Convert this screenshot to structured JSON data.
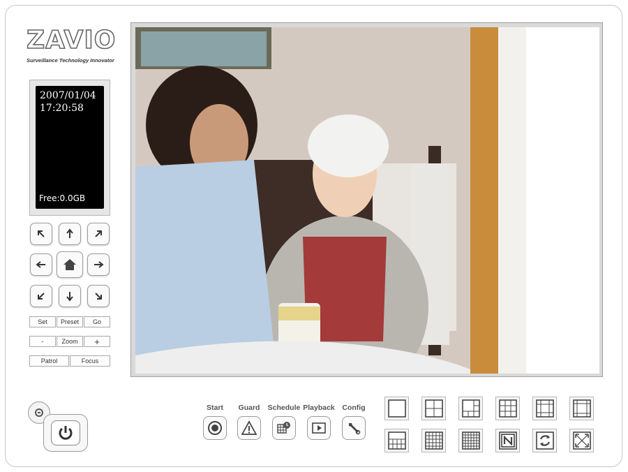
{
  "logo": {
    "text": "ZAVIO",
    "tagline": "Surveillance Technology Innovator"
  },
  "status": {
    "date": "2007/01/04",
    "time": "17:20:58",
    "free": "Free:0.0GB"
  },
  "ptz": {
    "set": "Set",
    "preset": "Preset",
    "go": "Go",
    "zoom_minus": "-",
    "zoom": "Zoom",
    "zoom_plus": "+",
    "patrol": "Patrol",
    "focus": "Focus"
  },
  "functions": [
    {
      "label": "Start",
      "icon": "record-icon"
    },
    {
      "label": "Guard",
      "icon": "warning-icon"
    },
    {
      "label": "Schedule",
      "icon": "schedule-icon"
    },
    {
      "label": "Playback",
      "icon": "play-icon"
    },
    {
      "label": "Config",
      "icon": "wrench-icon"
    }
  ],
  "layouts": [
    "1-view",
    "4-view",
    "6-view",
    "9-view",
    "13-view",
    "16-view",
    "20-view",
    "25-view",
    "36-view",
    "n-view",
    "auto-switch",
    "full-screen"
  ],
  "colors": {
    "accent": "#555555",
    "frame": "#c7c7c7"
  }
}
